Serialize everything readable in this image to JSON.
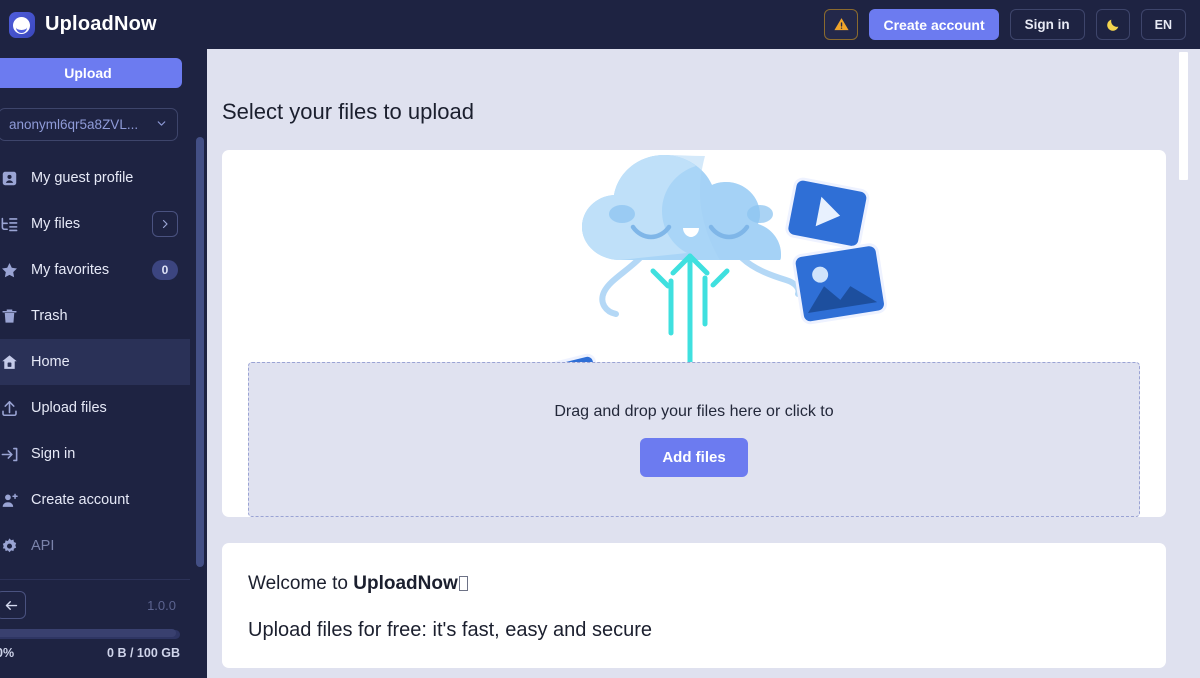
{
  "header": {
    "brand": "UploadNow",
    "logo_icon": "upload-cloud-logo-icon",
    "warning_icon": "warning-triangle-icon",
    "warning_label": "",
    "create_account": "Create account",
    "sign_in": "Sign in",
    "theme_icon": "moon-icon",
    "language": "EN",
    "accent": "#6c7bf0",
    "background": "#1e2342"
  },
  "sidebar": {
    "upload_button": "Upload",
    "account": {
      "value": "anonyml6qr5a8ZVL...",
      "chevron_icon": "chevron-down-icon"
    },
    "items": [
      {
        "label": "My guest profile",
        "icon": "contact-card-icon",
        "active": false,
        "muted": false
      },
      {
        "label": "My files",
        "icon": "file-tree-icon",
        "active": false,
        "muted": false,
        "trailing": "chevron-right-button"
      },
      {
        "label": "My favorites",
        "icon": "star-icon",
        "active": false,
        "muted": false,
        "badge": "0"
      },
      {
        "label": "Trash",
        "icon": "trash-icon",
        "active": false,
        "muted": false
      },
      {
        "label": "Home",
        "icon": "home-icon",
        "active": true,
        "muted": false
      },
      {
        "label": "Upload files",
        "icon": "upload-arrow-icon",
        "active": false,
        "muted": false
      },
      {
        "label": "Sign in",
        "icon": "sign-in-icon",
        "active": false,
        "muted": false
      },
      {
        "label": "Create account",
        "icon": "user-plus-icon",
        "active": false,
        "muted": false
      },
      {
        "label": "API",
        "icon": "gear-icon",
        "active": false,
        "muted": true
      }
    ],
    "footer": {
      "collapse_icon": "arrow-left-icon",
      "version": "1.0.0"
    },
    "storage": {
      "percent_label": "0%",
      "percent_value": 0,
      "usage": "0 B / 100 GB"
    }
  },
  "main": {
    "page_title": "Select your files to upload",
    "illustration": "cloud-mascot-upload-illustration",
    "dropzone": {
      "text": "Drag and drop your files here or click to",
      "button": "Add files"
    },
    "welcome": {
      "prefix": "Welcome to ",
      "brand": "UploadNow",
      "suffix_glyph": "missing-glyph",
      "subtitle": "Upload files for free: it's fast, easy and secure"
    }
  }
}
